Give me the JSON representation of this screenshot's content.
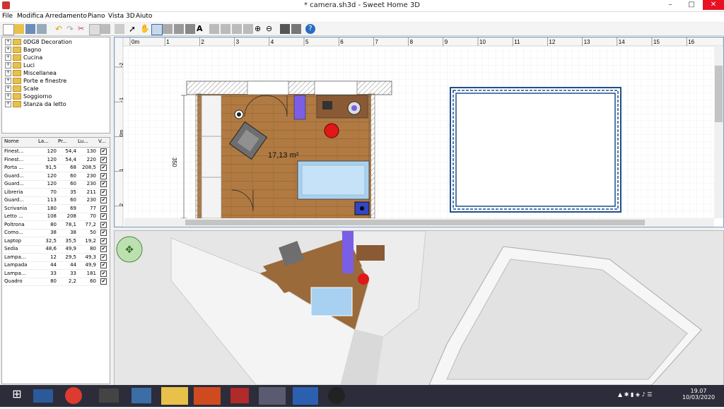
{
  "window": {
    "title": "* camera.sh3d - Sweet Home 3D",
    "controls": [
      "–",
      "□",
      "✕"
    ]
  },
  "menu": [
    "File",
    "Modifica",
    "Arredamento",
    "Piano",
    "Vista 3D",
    "Aiuto"
  ],
  "catalog": [
    "0DG8 Decoration",
    "Bagno",
    "Cucina",
    "Luci",
    "Miscellanea",
    "Porte e finestre",
    "Scale",
    "Soggiorno",
    "Stanza da letto"
  ],
  "furniture": {
    "columns": [
      "Nome",
      "La...",
      "Pr...",
      "Lu...",
      "V..."
    ],
    "rows": [
      [
        "Finest...",
        "120",
        "54,4",
        "130"
      ],
      [
        "Finest...",
        "120",
        "54,4",
        "220"
      ],
      [
        "Porta ...",
        "91,5",
        "68",
        "208,5"
      ],
      [
        "Guard...",
        "120",
        "60",
        "230"
      ],
      [
        "Guard...",
        "120",
        "60",
        "230"
      ],
      [
        "Libreria",
        "70",
        "35",
        "211"
      ],
      [
        "Guard...",
        "113",
        "60",
        "230"
      ],
      [
        "Scrivania",
        "180",
        "69",
        "77"
      ],
      [
        "Letto ...",
        "108",
        "208",
        "70"
      ],
      [
        "Poltrona",
        "80",
        "78,1",
        "77,2"
      ],
      [
        "Como...",
        "38",
        "38",
        "50"
      ],
      [
        "Laptop",
        "32,5",
        "35,5",
        "19,2"
      ],
      [
        "Sedia",
        "48,6",
        "49,9",
        "80"
      ],
      [
        "Lampa...",
        "12",
        "29,5",
        "49,3"
      ],
      [
        "Lampada",
        "44",
        "44",
        "49,9"
      ],
      [
        "Lampa...",
        "33",
        "33",
        "181"
      ],
      [
        "Quadro",
        "80",
        "2,2",
        "60"
      ]
    ],
    "visible_mark": "✔"
  },
  "plan": {
    "ruler_x": [
      "0m",
      "1",
      "2",
      "3",
      "4",
      "5",
      "6",
      "7",
      "8",
      "9",
      "10",
      "11",
      "12",
      "13",
      "14",
      "15",
      "16"
    ],
    "ruler_y": [
      "-2",
      "-1",
      "0m",
      "1",
      "2"
    ],
    "room_area": "17,13 m²",
    "dimension": "350"
  },
  "taskbar": {
    "time": "19.07",
    "date": "10/03/2020"
  },
  "colors": {
    "wall_hatch": "#9a9a9a",
    "floor": "#b07a42",
    "selected_wall": "#1f4e8c",
    "bed": "#a8d0f0",
    "accent": "#3a6ea5"
  }
}
